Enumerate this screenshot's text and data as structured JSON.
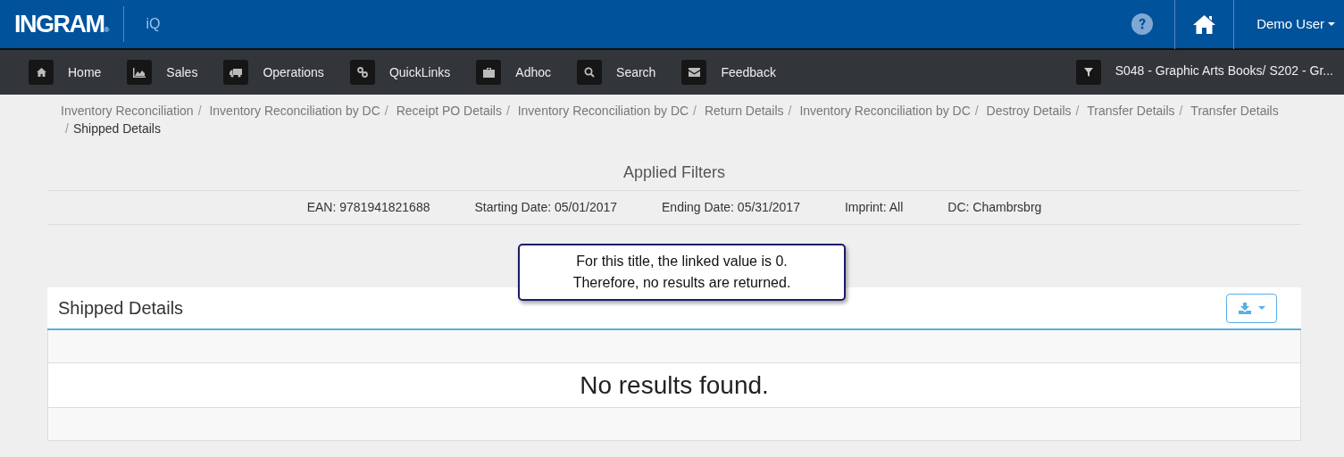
{
  "header": {
    "logo": "INGRAM",
    "logo_mark": "®",
    "app": "iQ",
    "user": "Demo User"
  },
  "nav": {
    "items": [
      {
        "label": "Home"
      },
      {
        "label": "Sales"
      },
      {
        "label": "Operations"
      },
      {
        "label": "QuickLinks"
      },
      {
        "label": "Adhoc"
      },
      {
        "label": "Search"
      },
      {
        "label": "Feedback"
      }
    ],
    "filter": "S048 - Graphic Arts Books/ S202 - Gr..."
  },
  "breadcrumb": {
    "separator": "/",
    "items": [
      "Inventory Reconciliation",
      "Inventory Reconciliation by DC",
      "Receipt PO Details",
      "Inventory Reconciliation by DC",
      "Return Details",
      "Inventory Reconciliation by DC",
      "Destroy Details",
      "Transfer Details",
      "Transfer Details",
      "Shipped Details"
    ]
  },
  "filters": {
    "title": "Applied Filters",
    "items": [
      "EAN: 9781941821688",
      "Starting Date: 05/01/2017",
      "Ending Date: 05/31/2017",
      "Imprint: All",
      "DC: Chambrsbrg"
    ]
  },
  "callout": "For this title, the linked value is 0. Therefore, no results are returned.",
  "panel": {
    "title": "Shipped Details",
    "empty_message": "No results found."
  }
}
